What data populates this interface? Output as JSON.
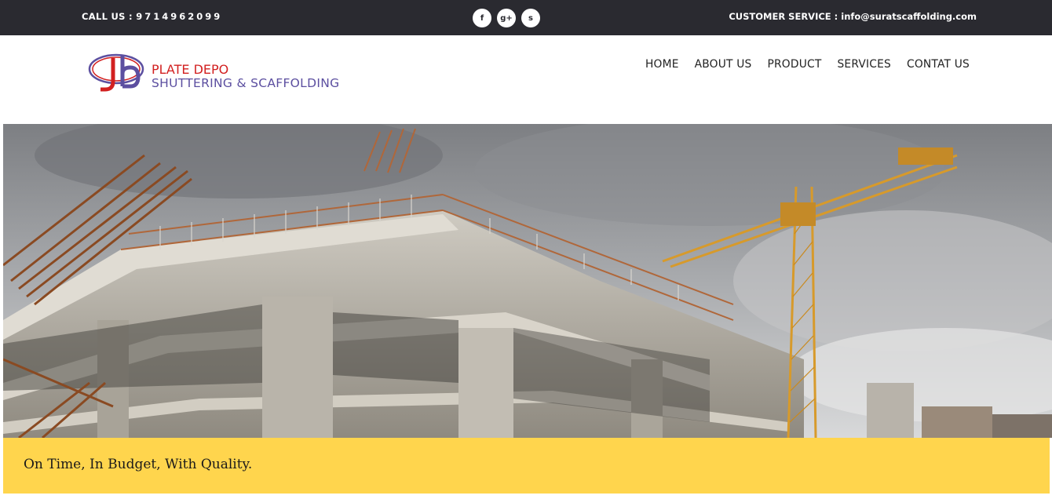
{
  "topbar": {
    "call_label": "CALL US : ",
    "call_number": "9714962099",
    "social": [
      {
        "icon": "facebook-icon",
        "glyph": "f"
      },
      {
        "icon": "google-plus-icon",
        "glyph": "g+"
      },
      {
        "icon": "skype-icon",
        "glyph": "s"
      }
    ],
    "service_text": "CUSTOMER SERVICE : info@suratscaffolding.com"
  },
  "logo": {
    "mark": "jb",
    "line1": "PLATE DEPO",
    "line2": "SHUTTERING & SCAFFOLDING"
  },
  "nav": {
    "items": [
      "HOME",
      "ABOUT US",
      "PRODUCT",
      "SERVICES",
      "CONTAT US"
    ]
  },
  "hero": {
    "image": "construction-site-photo"
  },
  "tagline": "On Time, In Budget, With Quality.",
  "colors": {
    "topbar_bg": "#2a2a30",
    "logo_red": "#d22020",
    "logo_purple": "#5c4fa0",
    "band_yellow": "#ffd54d"
  }
}
